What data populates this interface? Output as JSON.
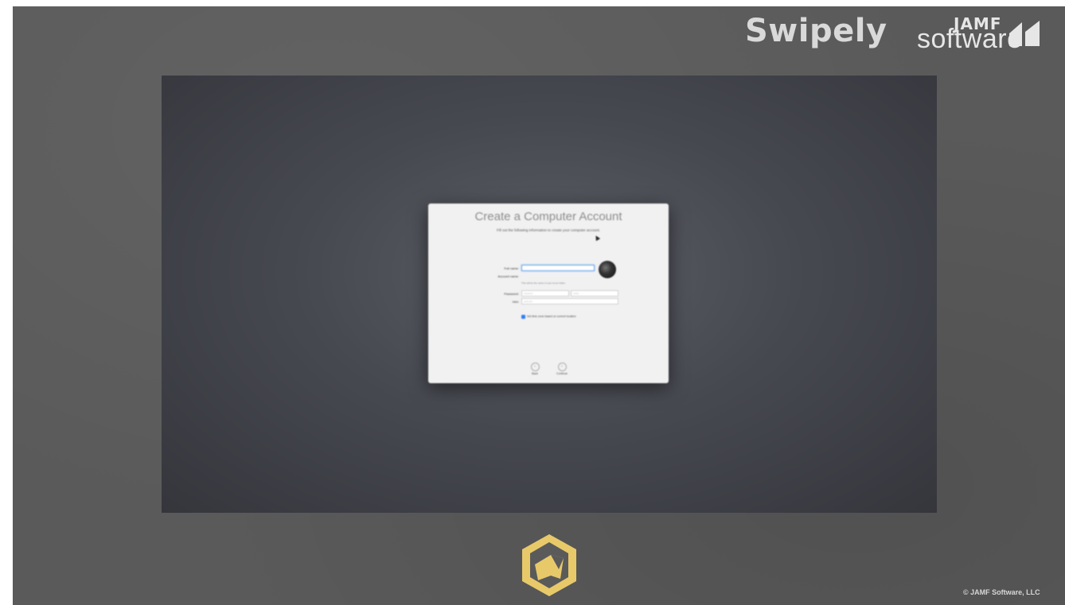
{
  "branding": {
    "swipely": "Swipely",
    "jamf_top": "JAMF",
    "jamf_bottom": "software"
  },
  "dialog": {
    "title": "Create a Computer Account",
    "subtitle": "Fill out the following information to create your computer account.",
    "fields": [
      {
        "label": "Full name:",
        "value": ""
      },
      {
        "label": "Account name:",
        "value": ""
      },
      {
        "label": "Password:",
        "value": "",
        "placeholder": "required",
        "verify_placeholder": "verify"
      },
      {
        "label": "Hint:",
        "value": "",
        "placeholder": "optional"
      }
    ],
    "account_hint": "This will be the name of your home folder.",
    "checkbox": {
      "label": "Set time zone based on current location",
      "checked": true
    },
    "back_label": "Back",
    "continue_label": "Continue",
    "back_icon": "chevron-left-icon",
    "continue_icon": "chevron-right-icon"
  },
  "footer": {
    "copyright": "© JAMF Software, LLC"
  },
  "colors": {
    "background": "#5a5a5a",
    "screen": "#45464d",
    "dialog": "#f1f1f2",
    "logo_gold": "#e8c96a",
    "checkbox_blue": "#2f7bf5"
  }
}
